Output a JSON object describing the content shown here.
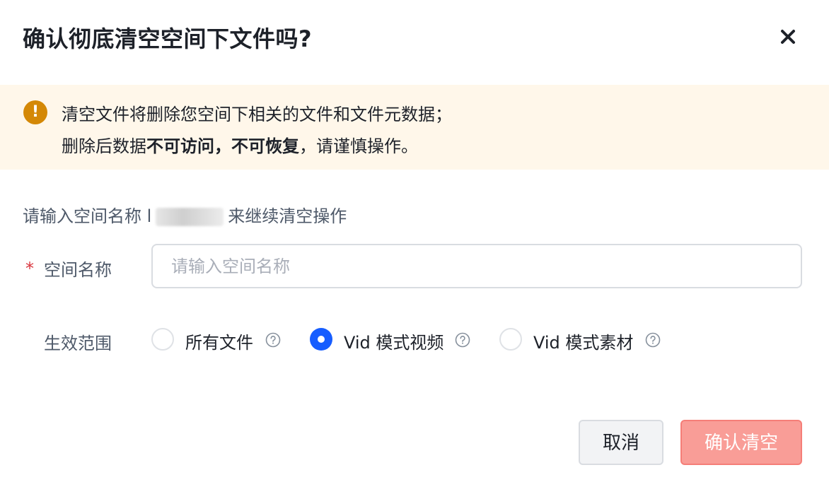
{
  "dialog": {
    "title": "确认彻底清空空间下文件吗?"
  },
  "alert": {
    "line1": "清空文件将删除您空间下相关的文件和文件元数据；",
    "line2_prefix": "删除后数据",
    "line2_bold": "不可访问，不可恢复",
    "line2_suffix": "，请谨慎操作。",
    "icon": "warning-icon",
    "icon_color": "#d48806"
  },
  "prompt": {
    "prefix": "请输入空间名称 l",
    "suffix": "来继续清空操作"
  },
  "form": {
    "required_mark": "*",
    "name_label": "空间名称",
    "name_placeholder": "请输入空间名称",
    "name_value": "",
    "scope_label": "生效范围",
    "scope_options": [
      {
        "label": "所有文件",
        "checked": false
      },
      {
        "label": "Vid 模式视频",
        "checked": true
      },
      {
        "label": "Vid 模式素材",
        "checked": false
      }
    ]
  },
  "buttons": {
    "cancel": "取消",
    "confirm": "确认清空"
  },
  "colors": {
    "primary": "#165dff",
    "danger_disabled": "#f99d97",
    "alert_bg": "#fff7ea",
    "required": "#d9363e"
  }
}
